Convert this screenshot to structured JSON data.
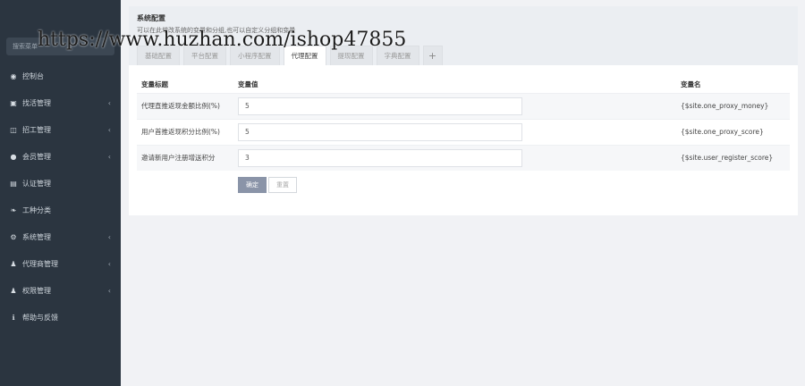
{
  "sidebar": {
    "search_placeholder": "搜索菜单",
    "items": [
      {
        "label": "控制台",
        "icon": "dashboard-icon",
        "glyph": "◉",
        "arrow": false
      },
      {
        "label": "找活管理",
        "icon": "id-card-icon",
        "glyph": "▣",
        "arrow": true
      },
      {
        "label": "招工管理",
        "icon": "columns-icon",
        "glyph": "◫",
        "arrow": true
      },
      {
        "label": "会员管理",
        "icon": "user-circle-icon",
        "glyph": "●",
        "arrow": true
      },
      {
        "label": "认证管理",
        "icon": "id-badge-icon",
        "glyph": "▤",
        "arrow": false
      },
      {
        "label": "工种分类",
        "icon": "leaf-icon",
        "glyph": "❧",
        "arrow": false
      },
      {
        "label": "系统管理",
        "icon": "cogs-icon",
        "glyph": "⚙",
        "arrow": true
      },
      {
        "label": "代理商管理",
        "icon": "users-icon",
        "glyph": "♟",
        "arrow": true
      },
      {
        "label": "权限管理",
        "icon": "users-icon",
        "glyph": "♟",
        "arrow": true
      },
      {
        "label": "帮助与反馈",
        "icon": "info-circle-icon",
        "glyph": "ℹ",
        "arrow": false
      }
    ],
    "arrow_glyph": "‹"
  },
  "header": {
    "title": "系统配置",
    "description": "可以在此增改系统的变量和分组,也可以自定义分组和变量"
  },
  "tabs": [
    {
      "label": "基础配置",
      "active": false
    },
    {
      "label": "平台配置",
      "active": false
    },
    {
      "label": "小程序配置",
      "active": false
    },
    {
      "label": "代理配置",
      "active": true
    },
    {
      "label": "提现配置",
      "active": false
    },
    {
      "label": "字典配置",
      "active": false
    }
  ],
  "tab_add_label": "+",
  "watermark": "https://www.huzhan.com/ishop47855",
  "table": {
    "headers": {
      "title": "变量标题",
      "value": "变量值",
      "name": "变量名"
    },
    "rows": [
      {
        "title": "代理直推返现金额比例(%)",
        "value": "5",
        "name": "{$site.one_proxy_money}"
      },
      {
        "title": "用户首推返现积分比例(%)",
        "value": "5",
        "name": "{$site.one_proxy_score}"
      },
      {
        "title": "邀请新用户注册增送积分",
        "value": "3",
        "name": "{$site.user_register_score}"
      }
    ]
  },
  "buttons": {
    "confirm": "确定",
    "reset": "重置"
  },
  "colors": {
    "sidebar_bg": "#2b3540",
    "primary_button": "#8a94a8",
    "page_bg": "#f1f2f5"
  }
}
